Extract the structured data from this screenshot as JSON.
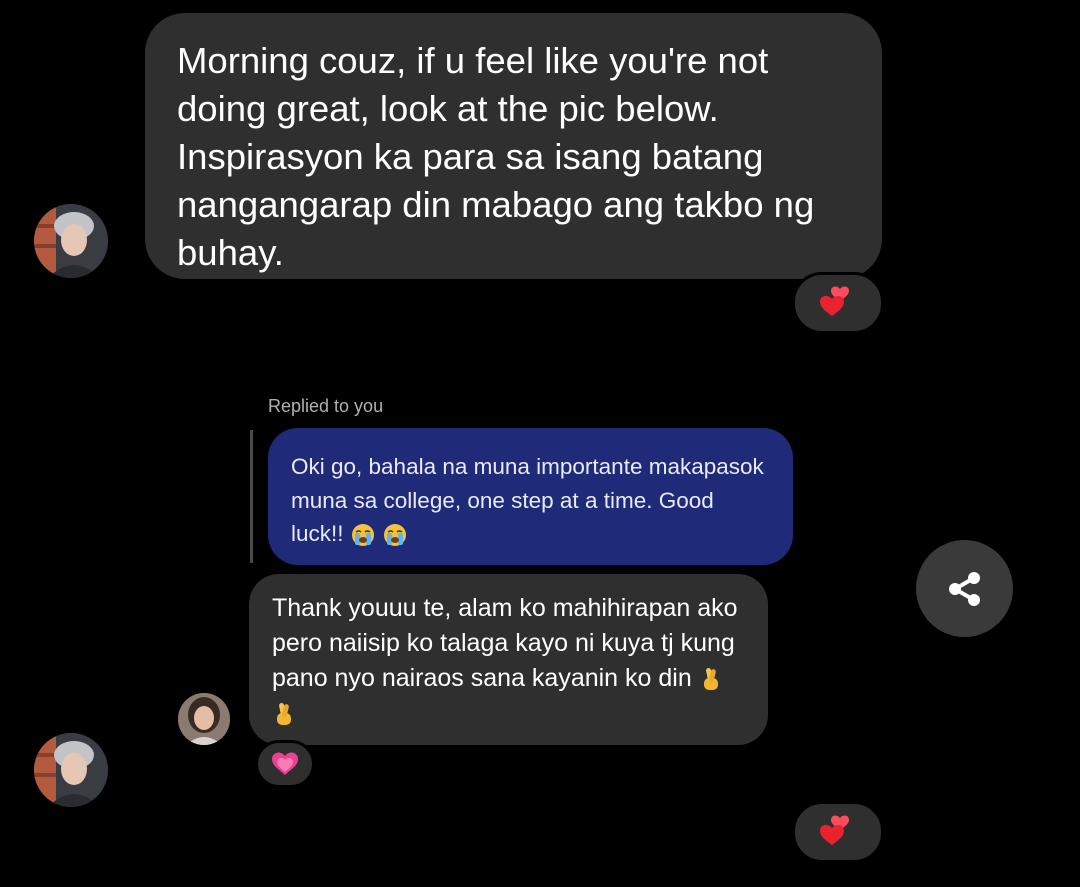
{
  "messages": [
    {
      "text": "Morning couz, if u feel like you're not doing great, look at the pic below. Inspirasyon ka para sa isang batang nangangarap din mabago ang takbo ng buhay.",
      "reaction": "two-hearts-icon"
    },
    {
      "reply_label": "Replied to you",
      "quoted_text": "Oki go, bahala na muna importante makapasok muna sa college, one step at a time. Good luck!!",
      "quoted_emoji": "loudly-crying-face-icon",
      "text": "Thank youuu te, alam ko mahihirapan ako pero naiisip ko talaga kayo ni kuya tj kung pano nyo nairaos sana kayanin ko din",
      "text_emoji": "crossed-fingers-icon",
      "reaction": "growing-heart-icon"
    }
  ],
  "bottom_reaction": "two-hearts-icon",
  "share_icon": "share-icon",
  "colors": {
    "background": "#000000",
    "incoming_bubble": "#2f2f2f",
    "quoted_bubble": "#1f2a78",
    "heart": "#e8232f",
    "pink_heart": "#ef3f8f"
  }
}
